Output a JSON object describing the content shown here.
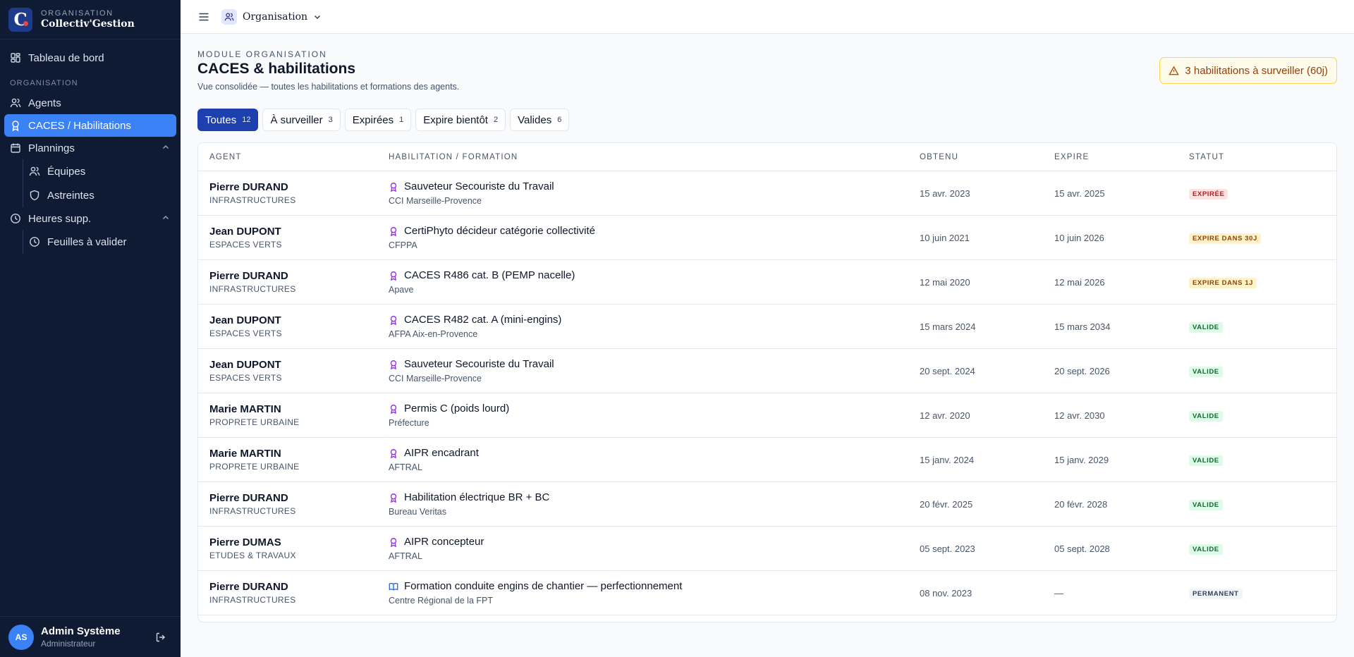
{
  "brand": {
    "kicker": "ORGANISATION",
    "name": "Collectiv'Gestion",
    "logo_letter": "C"
  },
  "sidebar": {
    "dashboard": "Tableau de bord",
    "section": "ORGANISATION",
    "agents": "Agents",
    "caces": "CACES / Habilitations",
    "plannings": "Plannings",
    "equipes": "Équipes",
    "astreintes": "Astreintes",
    "heures": "Heures supp.",
    "feuilles": "Feuilles à valider"
  },
  "user": {
    "initials": "AS",
    "name": "Admin Système",
    "role": "Administrateur"
  },
  "topbar": {
    "org": "Organisation"
  },
  "page": {
    "kicker": "MODULE ORGANISATION",
    "title": "CACES & habilitations",
    "subtitle": "Vue consolidée — toutes les habilitations et formations des agents.",
    "alert": "3 habilitations à surveiller (60j)"
  },
  "filters": [
    {
      "label": "Toutes",
      "count": "12"
    },
    {
      "label": "À surveiller",
      "count": "3"
    },
    {
      "label": "Expirées",
      "count": "1"
    },
    {
      "label": "Expire bientôt",
      "count": "2"
    },
    {
      "label": "Valides",
      "count": "6"
    }
  ],
  "table": {
    "headers": {
      "agent": "AGENT",
      "hab": "HABILITATION / FORMATION",
      "obtenu": "OBTENU",
      "expire": "EXPIRE",
      "statut": "STATUT"
    },
    "rows": [
      {
        "agent": "Pierre DURAND",
        "dept": "INFRASTRUCTURES",
        "hab": "Sauveteur Secouriste du Travail",
        "org": "CCI Marseille-Provence",
        "obtenu": "15 avr. 2023",
        "expire": "15 avr. 2025",
        "statut": "EXPIRÉE"
      },
      {
        "agent": "Jean DUPONT",
        "dept": "ESPACES VERTS",
        "hab": "CertiPhyto décideur catégorie collectivité",
        "org": "CFPPA",
        "obtenu": "10 juin 2021",
        "expire": "10 juin 2026",
        "statut": "EXPIRE DANS 30J"
      },
      {
        "agent": "Pierre DURAND",
        "dept": "INFRASTRUCTURES",
        "hab": "CACES R486 cat. B (PEMP nacelle)",
        "org": "Apave",
        "obtenu": "12 mai 2020",
        "expire": "12 mai 2026",
        "statut": "EXPIRE DANS 1J"
      },
      {
        "agent": "Jean DUPONT",
        "dept": "ESPACES VERTS",
        "hab": "CACES R482 cat. A (mini-engins)",
        "org": "AFPA Aix-en-Provence",
        "obtenu": "15 mars 2024",
        "expire": "15 mars 2034",
        "statut": "VALIDE"
      },
      {
        "agent": "Jean DUPONT",
        "dept": "ESPACES VERTS",
        "hab": "Sauveteur Secouriste du Travail",
        "org": "CCI Marseille-Provence",
        "obtenu": "20 sept. 2024",
        "expire": "20 sept. 2026",
        "statut": "VALIDE"
      },
      {
        "agent": "Marie MARTIN",
        "dept": "PROPRETE URBAINE",
        "hab": "Permis C (poids lourd)",
        "org": "Préfecture",
        "obtenu": "12 avr. 2020",
        "expire": "12 avr. 2030",
        "statut": "VALIDE"
      },
      {
        "agent": "Marie MARTIN",
        "dept": "PROPRETE URBAINE",
        "hab": "AIPR encadrant",
        "org": "AFTRAL",
        "obtenu": "15 janv. 2024",
        "expire": "15 janv. 2029",
        "statut": "VALIDE"
      },
      {
        "agent": "Pierre DURAND",
        "dept": "INFRASTRUCTURES",
        "hab": "Habilitation électrique BR + BC",
        "org": "Bureau Veritas",
        "obtenu": "20 févr. 2025",
        "expire": "20 févr. 2028",
        "statut": "VALIDE"
      },
      {
        "agent": "Pierre DUMAS",
        "dept": "ETUDES & TRAVAUX",
        "hab": "AIPR concepteur",
        "org": "AFTRAL",
        "obtenu": "05 sept. 2023",
        "expire": "05 sept. 2028",
        "statut": "VALIDE"
      },
      {
        "agent": "Pierre DURAND",
        "dept": "INFRASTRUCTURES",
        "hab": "Formation conduite engins de chantier — perfectionnement",
        "org": "Centre Régional de la FPT",
        "obtenu": "08 nov. 2023",
        "expire": "—",
        "statut": "PERMANENT"
      }
    ]
  },
  "colors": {
    "sidebar_bg": "#0f1b33",
    "accent": "#3b82f6",
    "filter_active": "#1e40af",
    "award_icon": "#9333ea",
    "book_icon": "#2563eb"
  }
}
